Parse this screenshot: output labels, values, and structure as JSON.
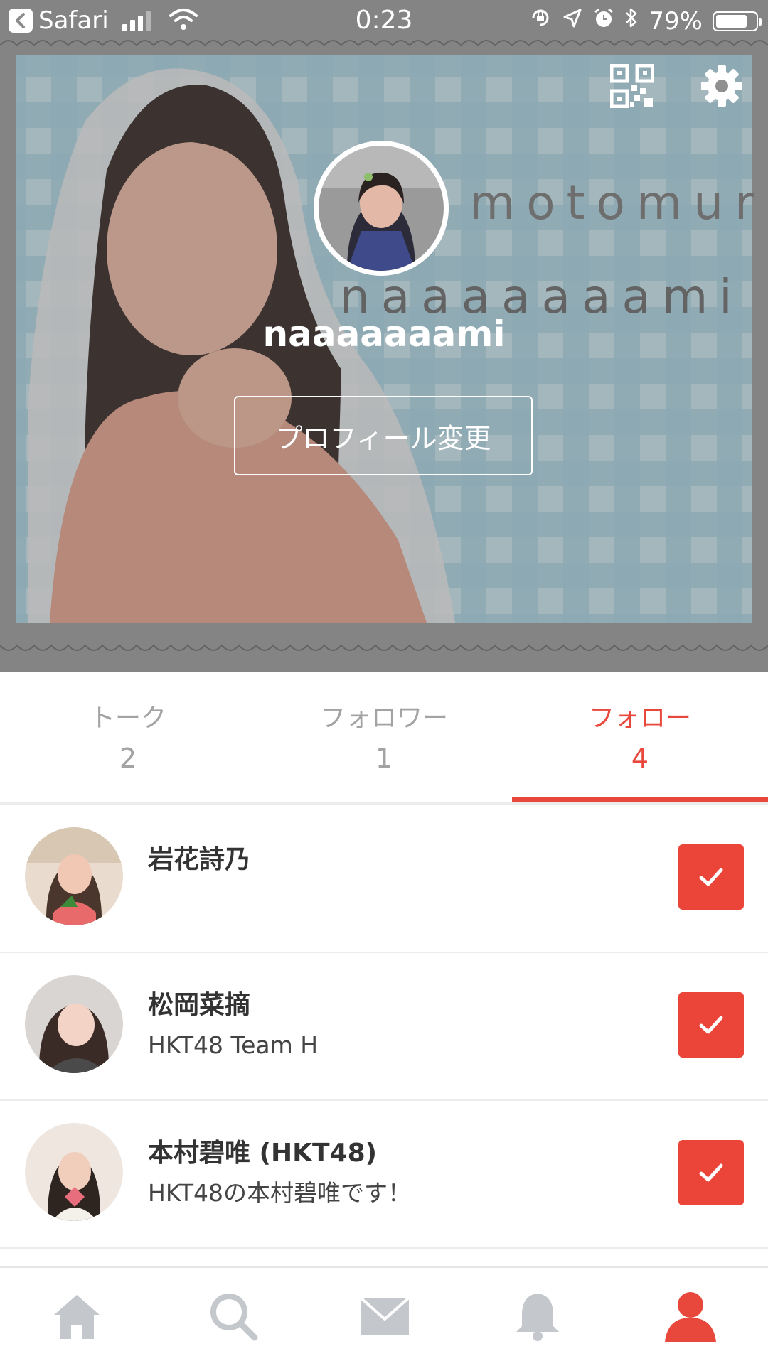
{
  "status_bar": {
    "back_app": "Safari",
    "time": "0:23",
    "battery_percent": "79%",
    "battery_level": 0.79,
    "icons": [
      "back-chevron-icon",
      "cellular-signal-icon",
      "wifi-icon",
      "orientation-lock-icon",
      "location-arrow-icon",
      "alarm-clock-icon",
      "bluetooth-icon",
      "battery-icon"
    ]
  },
  "header": {
    "username": "naaaaaaami",
    "edit_profile_label": "プロフィール変更",
    "icons": [
      "qr-code-icon",
      "gear-icon"
    ],
    "background_text": {
      "line1": "motomura",
      "line2": "naaaaaaami"
    }
  },
  "tabs": [
    {
      "label": "トーク",
      "count": "2",
      "active": false
    },
    {
      "label": "フォロワー",
      "count": "1",
      "active": false
    },
    {
      "label": "フォロー",
      "count": "4",
      "active": true
    }
  ],
  "follow_list": [
    {
      "name": "岩花詩乃",
      "description": "",
      "followed": true
    },
    {
      "name": "松岡菜摘",
      "description": "HKT48 Team H",
      "followed": true
    },
    {
      "name": "本村碧唯 (HKT48)",
      "description": "HKT48の本村碧唯です！",
      "followed": true
    }
  ],
  "bottom_nav": {
    "items": [
      "home-icon",
      "search-icon",
      "mail-icon",
      "bell-icon",
      "profile-icon"
    ],
    "active": "profile-icon"
  },
  "colors": {
    "accent": "#e8473c",
    "checkbox": "#ea4538",
    "inactive": "#a3a3a3",
    "nav_inactive": "#c4c8cc",
    "header_bg_check": "#a9cfdd"
  }
}
